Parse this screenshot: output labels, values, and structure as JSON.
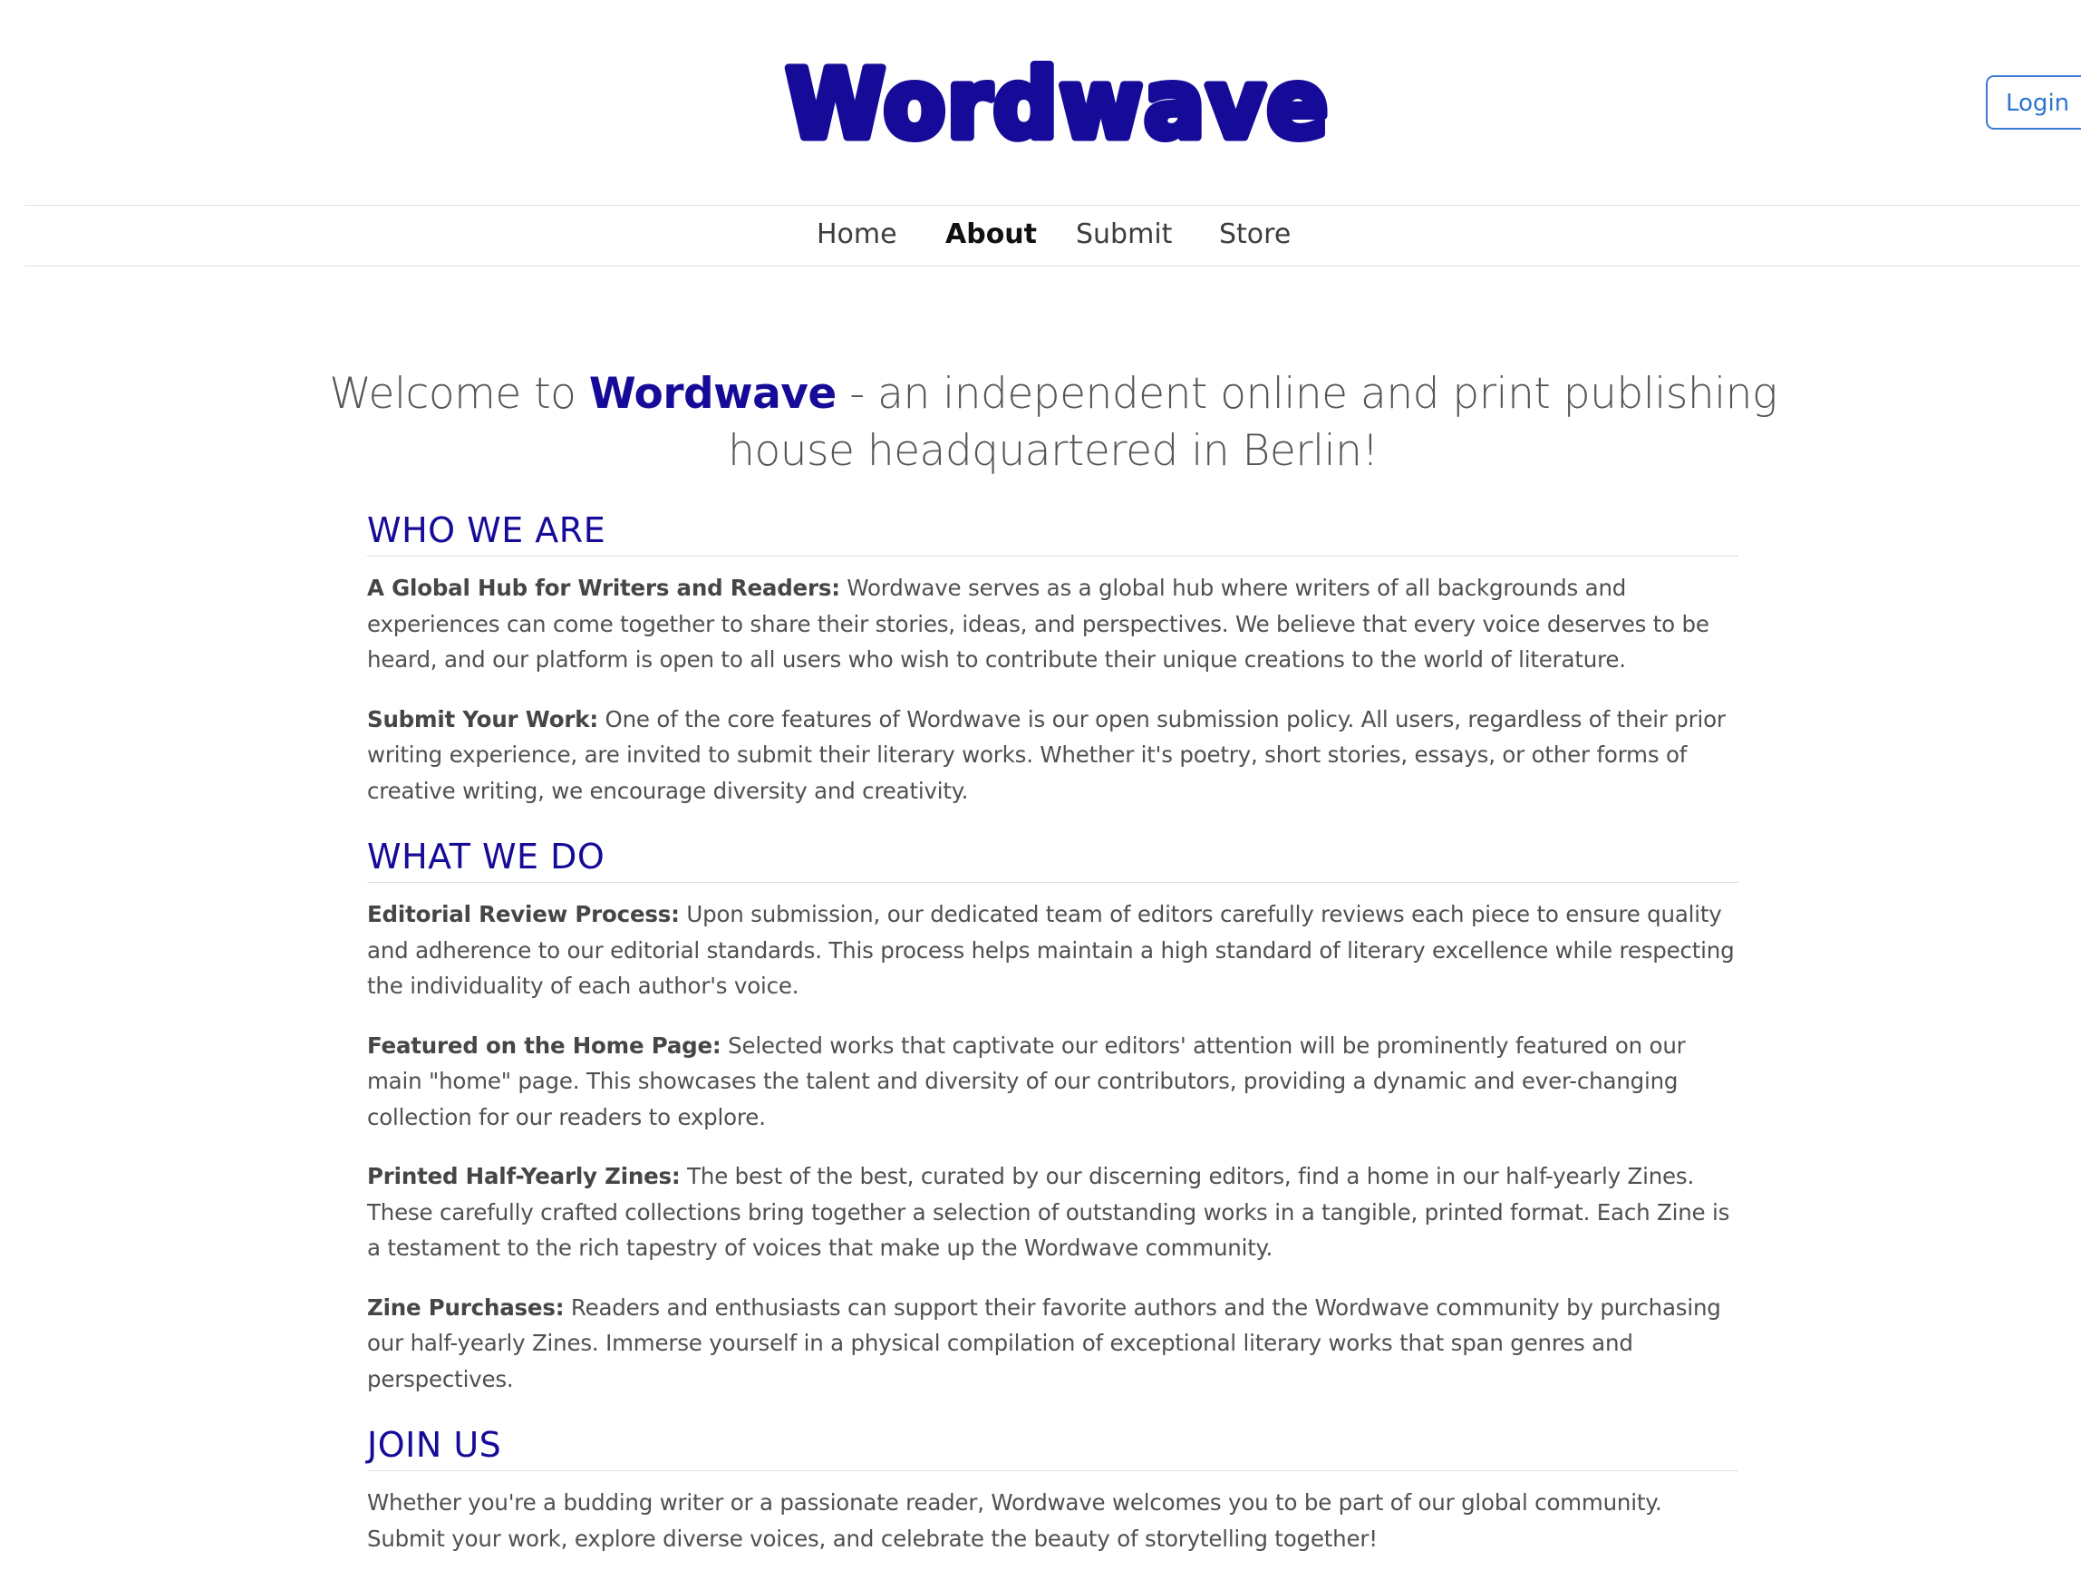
{
  "header": {
    "logo_text": "Wordwave",
    "login_label": "Login"
  },
  "nav": {
    "items": [
      {
        "label": "Home"
      },
      {
        "label": "About",
        "active": true
      },
      {
        "label": "Submit"
      },
      {
        "label": "Store"
      }
    ]
  },
  "welcome": {
    "prefix": "Welcome to ",
    "brand": "Wordwave",
    "suffix": " - an independent online and print publishing house headquartered in Berlin!"
  },
  "sections": [
    {
      "title": "WHO WE ARE",
      "paragraphs": [
        {
          "lead": "A Global Hub for Writers and Readers:",
          "text": " Wordwave serves as a global hub where writers of all backgrounds and experiences can come together to share their stories, ideas, and perspectives. We believe that every voice deserves to be heard, and our platform is open to all users who wish to contribute their unique creations to the world of literature."
        },
        {
          "lead": "Submit Your Work:",
          "text": " One of the core features of Wordwave is our open submission policy. All users, regardless of their prior writing experience, are invited to submit their literary works. Whether it's poetry, short stories, essays, or other forms of creative writing, we encourage diversity and creativity."
        }
      ]
    },
    {
      "title": "WHAT WE DO",
      "paragraphs": [
        {
          "lead": "Editorial Review Process:",
          "text": " Upon submission, our dedicated team of editors carefully reviews each piece to ensure quality and adherence to our editorial standards. This process helps maintain a high standard of literary excellence while respecting the individuality of each author's voice."
        },
        {
          "lead": "Featured on the Home Page:",
          "text": " Selected works that captivate our editors' attention will be prominently featured on our main \"home\" page. This showcases the talent and diversity of our contributors, providing a dynamic and ever-changing collection for our readers to explore."
        },
        {
          "lead": "Printed Half-Yearly Zines:",
          "text": " The best of the best, curated by our discerning editors, find a home in our half-yearly Zines. These carefully crafted collections bring together a selection of outstanding works in a tangible, printed format. Each Zine is a testament to the rich tapestry of voices that make up the Wordwave community."
        },
        {
          "lead": "Zine Purchases:",
          "text": " Readers and enthusiasts can support their favorite authors and the Wordwave community by purchasing our half-yearly Zines. Immerse yourself in a physical compilation of exceptional literary works that span genres and perspectives."
        }
      ]
    },
    {
      "title": "JOIN US",
      "paragraphs": [
        {
          "lead": "",
          "text": "Whether you're a budding writer or a passionate reader, Wordwave welcomes you to be part of our global community. Submit your work, explore diverse voices, and celebrate the beauty of storytelling together!"
        }
      ]
    }
  ],
  "colors": {
    "brand": "#160b98",
    "login_border": "#3b7bd6",
    "body_text": "#505050"
  }
}
